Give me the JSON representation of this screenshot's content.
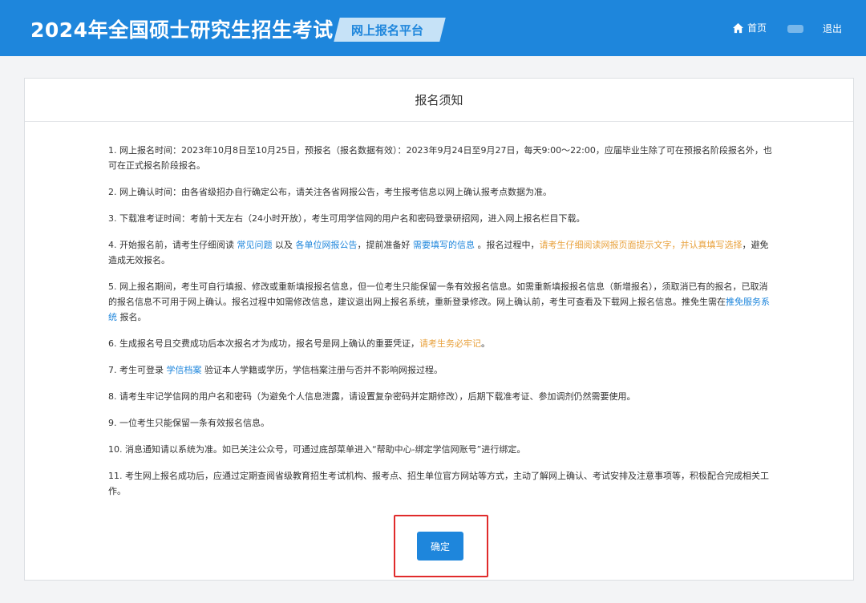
{
  "header": {
    "title": "2024年全国硕士研究生招生考试",
    "platform": "网上报名平台",
    "nav": {
      "home_label": "首页",
      "logout_label": "退出"
    },
    "colors": {
      "bar": "#1e86dc",
      "badge": "#c6e2f7"
    },
    "icons": {
      "home": "home-icon"
    }
  },
  "card": {
    "title": "报名须知"
  },
  "notices": {
    "n1": "1. 网上报名时间：2023年10月8日至10月25日，预报名（报名数据有效）：2023年9月24日至9月27日，每天9:00～22:00，应届毕业生除了可在预报名阶段报名外，也可在正式报名阶段报名。",
    "n2": "2. 网上确认时间：由各省级招办自行确定公布，请关注各省网报公告，考生报考信息以网上确认报考点数据为准。",
    "n3": "3. 下载准考证时间：考前十天左右（24小时开放），考生可用学信网的用户名和密码登录研招网，进入网上报名栏目下载。",
    "n4": {
      "p1": "4. 开始报名前，请考生仔细阅读 ",
      "link1": "常见问题",
      "p2": " 以及 ",
      "link2": "各单位网报公告",
      "p3": "，提前准备好 ",
      "link3": "需要填写的信息",
      "p4": " 。报名过程中，",
      "warn": "请考生仔细阅读网报页面提示文字，并认真填写选择",
      "p5": "，避免造成无效报名。"
    },
    "n5": {
      "p1": "5. 网上报名期间，考生可自行填报、修改或重新填报报名信息，但一位考生只能保留一条有效报名信息。如需重新填报报名信息（新增报名），须取消已有的报名，已取消的报名信息不可用于网上确认。报名过程中如需修改信息，建议退出网上报名系统，重新登录修改。网上确认前，考生可查看及下载网上报名信息。推免生需在",
      "link": "推免服务系统",
      "p2": " 报名。"
    },
    "n6": {
      "p1": "6. 生成报名号且交费成功后本次报名才为成功，报名号是网上确认的重要凭证，",
      "warn": "请考生务必牢记",
      "p2": "。"
    },
    "n7": {
      "p1": "7. 考生可登录 ",
      "link": "学信档案",
      "p2": " 验证本人学籍或学历，学信档案注册与否并不影响网报过程。"
    },
    "n8": "8. 请考生牢记学信网的用户名和密码（为避免个人信息泄露，请设置复杂密码并定期修改），后期下载准考证、参加调剂仍然需要使用。",
    "n9": "9. 一位考生只能保留一条有效报名信息。",
    "n10": "10. 消息通知请以系统为准。如已关注公众号，可通过底部菜单进入“帮助中心-绑定学信网账号”进行绑定。",
    "n11": "11. 考生网上报名成功后，应通过定期查阅省级教育招生考试机构、报考点、招生单位官方网站等方式，主动了解网上确认、考试安排及注意事项等，积极配合完成相关工作。"
  },
  "confirm": {
    "label": "确定",
    "highlight_color": "#e02b2b"
  },
  "colors": {
    "link": "#1e86dc",
    "warning": "#e8a13c"
  }
}
